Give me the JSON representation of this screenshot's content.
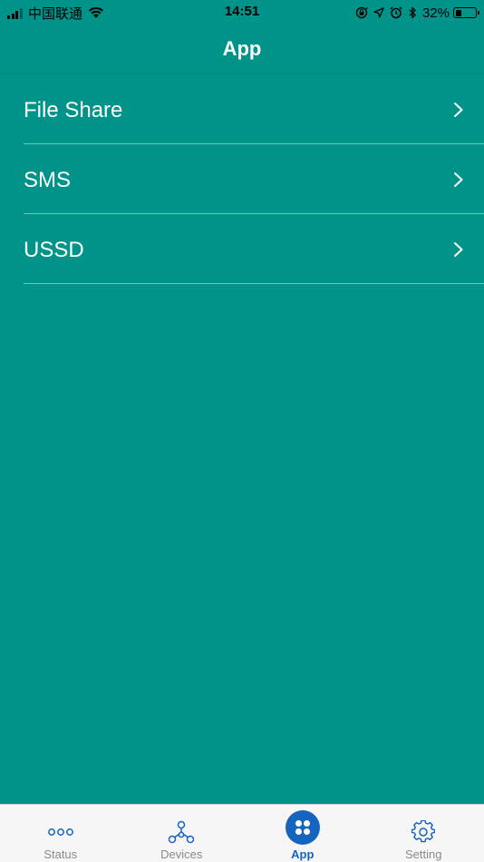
{
  "status_bar": {
    "carrier": "中国联通",
    "time": "14:51",
    "battery_percent": "32%",
    "battery_level": 0.32,
    "icons": [
      "signal-icon",
      "wifi-icon",
      "screen-lock-icon",
      "location-icon",
      "alarm-icon",
      "bluetooth-icon",
      "battery-icon"
    ]
  },
  "nav": {
    "title": "App"
  },
  "list": {
    "items": [
      {
        "label": "File Share",
        "icon": "chevron-right-icon"
      },
      {
        "label": "SMS",
        "icon": "chevron-right-icon"
      },
      {
        "label": "USSD",
        "icon": "chevron-right-icon"
      }
    ]
  },
  "tab_bar": {
    "tabs": [
      {
        "label": "Status",
        "icon": "dots-icon"
      },
      {
        "label": "Devices",
        "icon": "devices-network-icon"
      },
      {
        "label": "App",
        "icon": "app-grid-icon",
        "active": true
      },
      {
        "label": "Setting",
        "icon": "gear-icon"
      }
    ]
  },
  "colors": {
    "background": "#00938a",
    "tab_bar_background": "#f6f6f6",
    "active_tab": "#1565c0",
    "inactive_tab_label": "#8a8a8a"
  }
}
